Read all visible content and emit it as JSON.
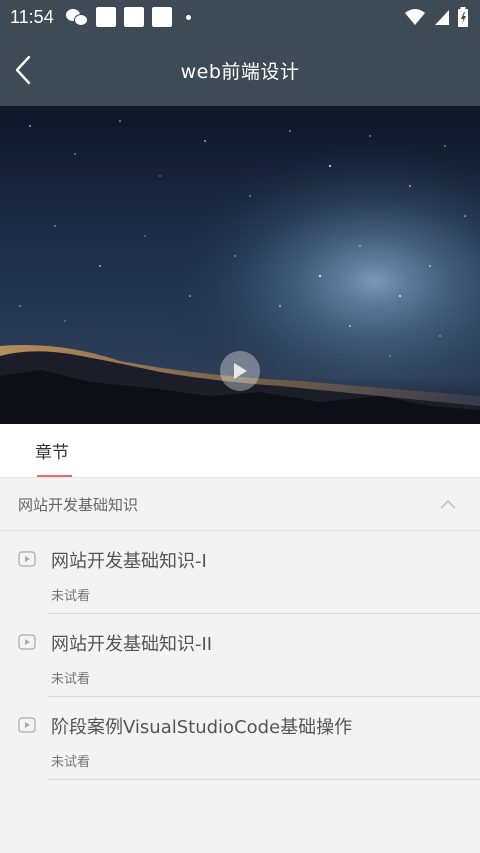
{
  "status": {
    "time": "11:54"
  },
  "header": {
    "title": "web前端设计",
    "back_icon": "chevron-left-icon"
  },
  "video": {
    "play_icon": "play-icon"
  },
  "tabs": [
    {
      "label": "章节",
      "active": true
    }
  ],
  "section": {
    "title": "网站开发基础知识",
    "expanded": true,
    "lessons": [
      {
        "title": "网站开发基础知识-I",
        "status": "未试看"
      },
      {
        "title": "网站开发基础知识-II",
        "status": "未试看"
      },
      {
        "title": "阶段案例VisualStudioCode基础操作",
        "status": "未试看"
      }
    ]
  },
  "colors": {
    "header_bg": "#3e4a55",
    "accent": "#f06a5d"
  }
}
